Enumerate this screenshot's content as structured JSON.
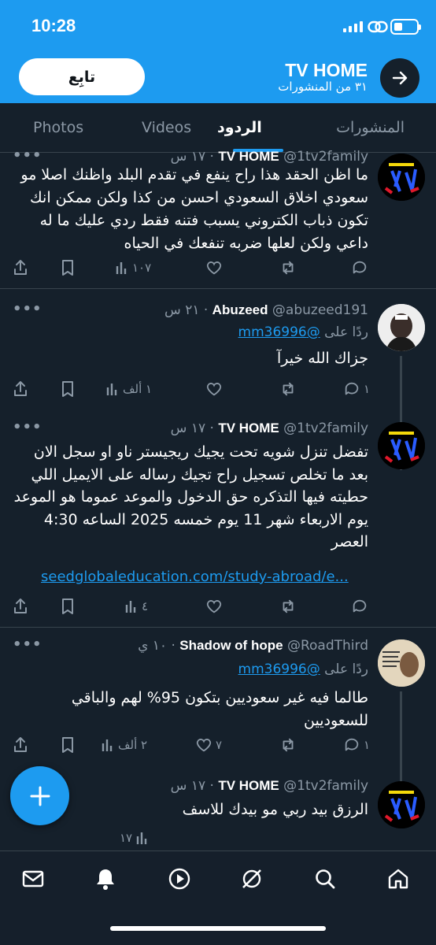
{
  "status_bar": {
    "time": "10:28"
  },
  "profile": {
    "name": "TV HOME",
    "posts_count": "٣١ من المنشورات",
    "follow_label": "تابِع"
  },
  "tabs": [
    {
      "label": "المنشورات"
    },
    {
      "label": "الردود"
    },
    {
      "label": "Videos"
    },
    {
      "label": "Photos"
    }
  ],
  "tweets": [
    {
      "name": "TV HOME",
      "handle": "@1tv2family",
      "time": "١٧ س",
      "text": "ما اظن الحقد هذا راح ينفع في تقدم البلد واظنك اصلا مو سعودي اخلاق السعودي احسن من كذا ولكن ممكن انك تكون ذباب الكتروني يسبب فتنه فقط ردي عليك ما له داعي ولكن لعلها ضربه تنفعك في الحياه",
      "replies": "",
      "reposts": "",
      "likes": "",
      "views": "١٠٧"
    },
    {
      "name": "Abuzeed",
      "handle": "@abuzeed191",
      "time": "٢١ س",
      "reply_prefix": "ردًا على",
      "reply_to": "@mm36996",
      "text": "جزاك الله خيرآ",
      "replies": "١",
      "reposts": "",
      "likes": "",
      "views": "١ ألف"
    },
    {
      "name": "TV HOME",
      "handle": "@1tv2family",
      "time": "١٧ س",
      "text": "تفضل تنزل شويه تحت يجيك ريجيستر ناو او سجل الان بعد ما تخلص تسجيل راح تجيك رساله على الايميل اللي حطيته فيها التذكره حق الدخول والموعد عموما هو الموعد يوم الاربعاء شهر 11 يوم خمسه 2025 الساعه 4:30 العصر",
      "link": "seedglobaleducation.com/study-abroad/e...",
      "replies": "",
      "reposts": "",
      "likes": "",
      "views": "٤"
    },
    {
      "name": "Shadow of hope",
      "handle": "@RoadThird",
      "time": "١٠ ي",
      "reply_prefix": "ردًا على",
      "reply_to": "@mm36996",
      "text": "طالما فيه غير سعوديين بتكون 95% لهم والباقي للسعوديين",
      "replies": "١",
      "reposts": "",
      "likes": "٧",
      "views": "٢ ألف"
    },
    {
      "name": "TV HOME",
      "handle": "@1tv2family",
      "time": "١٧ س",
      "text": "الرزق بيد ربي مو بيدك للاسف",
      "views": "١٧"
    }
  ],
  "icons": {
    "more": "more-dots-icon",
    "reply": "reply-bubble-icon",
    "repost": "repost-icon",
    "like": "heart-icon",
    "views": "views-bars-icon",
    "bookmark": "bookmark-icon",
    "share": "share-icon",
    "compose": "plus-icon",
    "nav": [
      "mail-icon",
      "bell-icon",
      "play-icon",
      "grok-icon",
      "search-icon",
      "home-icon"
    ]
  },
  "colors": {
    "accent": "#1d9bf0",
    "background": "#15202b",
    "muted": "#8b98a5"
  }
}
